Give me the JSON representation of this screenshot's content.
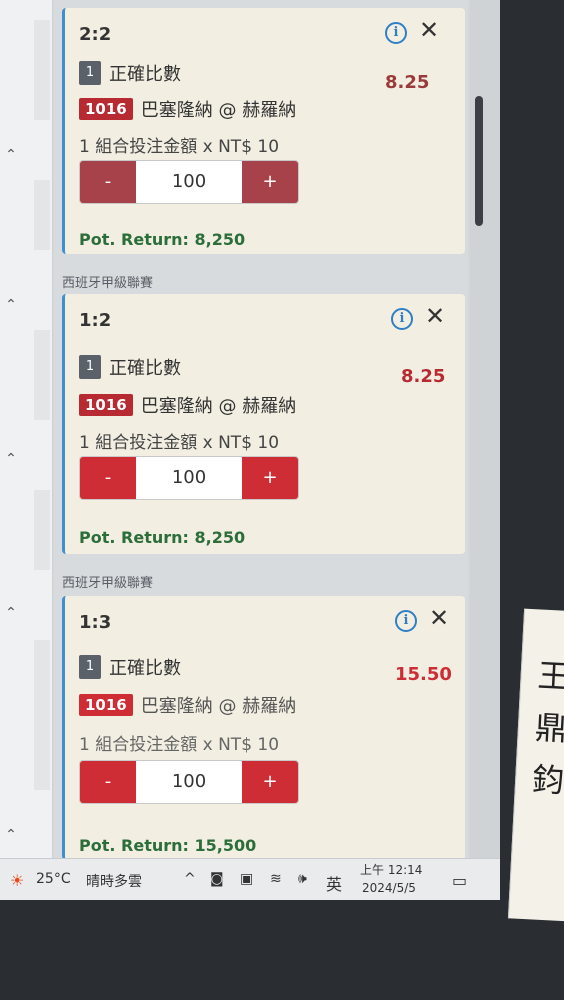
{
  "bets": [
    {
      "league": "",
      "score": "2:2",
      "quantity": "1",
      "bet_type": "正確比數",
      "odds": "8.25",
      "match_id": "1016",
      "match": "巴塞隆納 @ 赫羅納",
      "stake_line": "1 組合投注金額 x NT$ 10",
      "stake_value": "100",
      "minus_label": "-",
      "plus_label": "+",
      "potential_return": "Pot. Return: 8,250"
    },
    {
      "league": "西班牙甲級聯賽",
      "score": "1:2",
      "quantity": "1",
      "bet_type": "正確比數",
      "odds": "8.25",
      "match_id": "1016",
      "match": "巴塞隆納 @ 赫羅納",
      "stake_line": "1 組合投注金額 x NT$ 10",
      "stake_value": "100",
      "minus_label": "-",
      "plus_label": "+",
      "potential_return": "Pot. Return: 8,250"
    },
    {
      "league": "西班牙甲級聯賽",
      "score": "1:3",
      "quantity": "1",
      "bet_type": "正確比數",
      "odds": "15.50",
      "match_id": "1016",
      "match": "巴塞隆納 @ 赫羅納",
      "stake_line": "1 組合投注金額 x NT$ 10",
      "stake_value": "100",
      "minus_label": "-",
      "plus_label": "+",
      "potential_return": "Pot. Return: 15,500"
    }
  ],
  "taskbar": {
    "temperature": "25°C",
    "weather": "晴時多雲",
    "input_method": "英",
    "time": "上午 12:14",
    "date": "2024/5/5"
  },
  "sticker": {
    "text": "王鼎鈞"
  },
  "colors": {
    "accent_red": "#cf2d35",
    "odds_red": "#b72a32",
    "return_green": "#2c6e3a",
    "info_blue": "#2f7fc6",
    "card_bg": "#f2efe2"
  }
}
